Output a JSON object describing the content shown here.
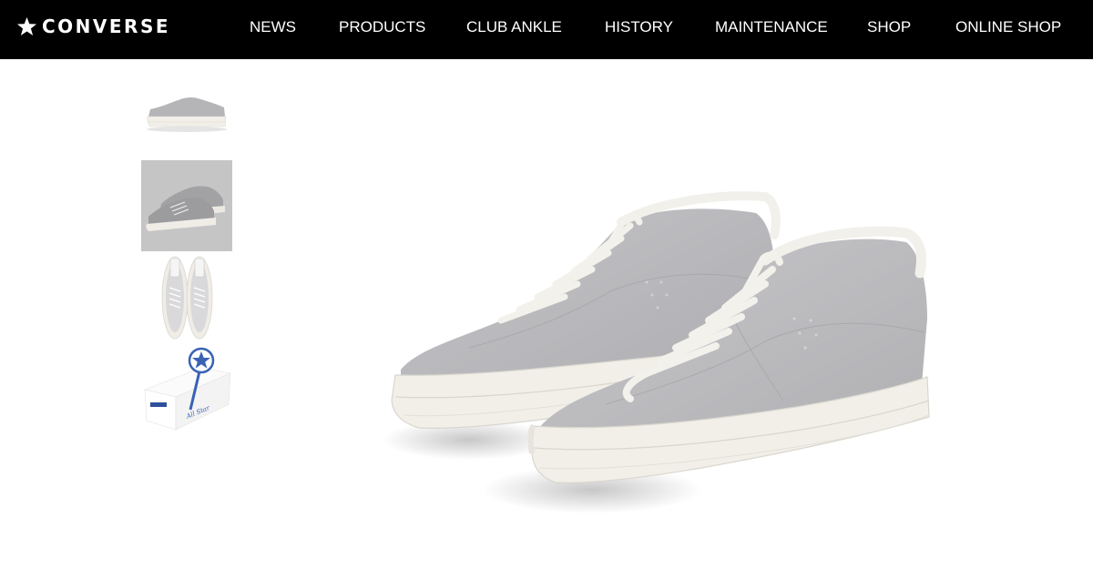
{
  "header": {
    "brand": "CONVERSE",
    "nav": [
      {
        "label": "NEWS"
      },
      {
        "label": "PRODUCTS"
      },
      {
        "label": "CLUB ANKLE"
      },
      {
        "label": "HISTORY"
      },
      {
        "label": "MAINTENANCE"
      },
      {
        "label": "SHOP"
      },
      {
        "label": "ONLINE SHOP"
      }
    ]
  },
  "gallery": {
    "thumbnails": [
      {
        "icon": "sneaker-side-icon",
        "active": false
      },
      {
        "icon": "sneaker-pair-icon",
        "active": true
      },
      {
        "icon": "sneaker-top-view-icon",
        "active": false
      },
      {
        "icon": "shoe-box-icon",
        "active": false
      }
    ],
    "box_print": "All Star"
  },
  "colors": {
    "header_bg": "#000000",
    "suede": "#b9b9bc",
    "sole": "#f1efe8",
    "active_thumb_bg": "#c5c5c5",
    "star_blue": "#3a62b4"
  }
}
